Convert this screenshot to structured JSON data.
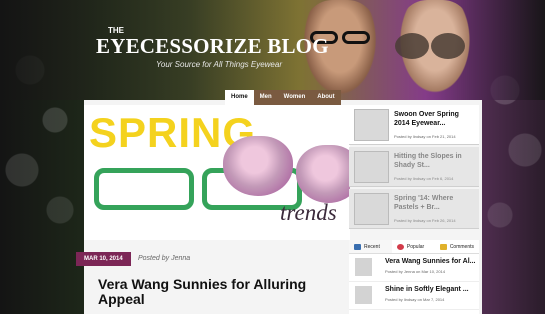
{
  "brand": {
    "the": "THE",
    "title": "EYECESSORIZE BLOG",
    "tagline": "Your Source for All Things Eyewear"
  },
  "nav": [
    {
      "label": "Home"
    },
    {
      "label": "Men"
    },
    {
      "label": "Women"
    },
    {
      "label": "About"
    }
  ],
  "hero": {
    "word": "SPRING",
    "script": "trends"
  },
  "featured": [
    {
      "title": "Swoon Over Spring 2014 Eyewear...",
      "meta": "Posted by lindsay on Feb 21, 2014"
    },
    {
      "title": "Hitting the Slopes in Shady St...",
      "meta": "Posted by lindsay on Feb 6, 2014"
    },
    {
      "title": "Spring '14: Where Pastels + Br...",
      "meta": "Posted by lindsay on Feb 26, 2014"
    }
  ],
  "post": {
    "date": "MAR 10, 2014",
    "posted_by": "Posted by Jenna",
    "title": "Vera Wang Sunnies for Alluring Appeal"
  },
  "sidebar": {
    "tabs": [
      {
        "label": "Recent",
        "icon": "recent-icon"
      },
      {
        "label": "Popular",
        "icon": "heart-icon"
      },
      {
        "label": "Comments",
        "icon": "comment-icon"
      }
    ],
    "items": [
      {
        "title": "Vera Wang Sunnies for Al...",
        "meta": "Posted by Jenna on Mar 10, 2014"
      },
      {
        "title": "Shine in Softly Elegant ...",
        "meta": "Posted by lindsay on Mar 7, 2014"
      }
    ]
  },
  "colors": {
    "accent": "#7c2656",
    "hero_yellow": "#f4d21e",
    "frame_green": "#35a35a"
  }
}
